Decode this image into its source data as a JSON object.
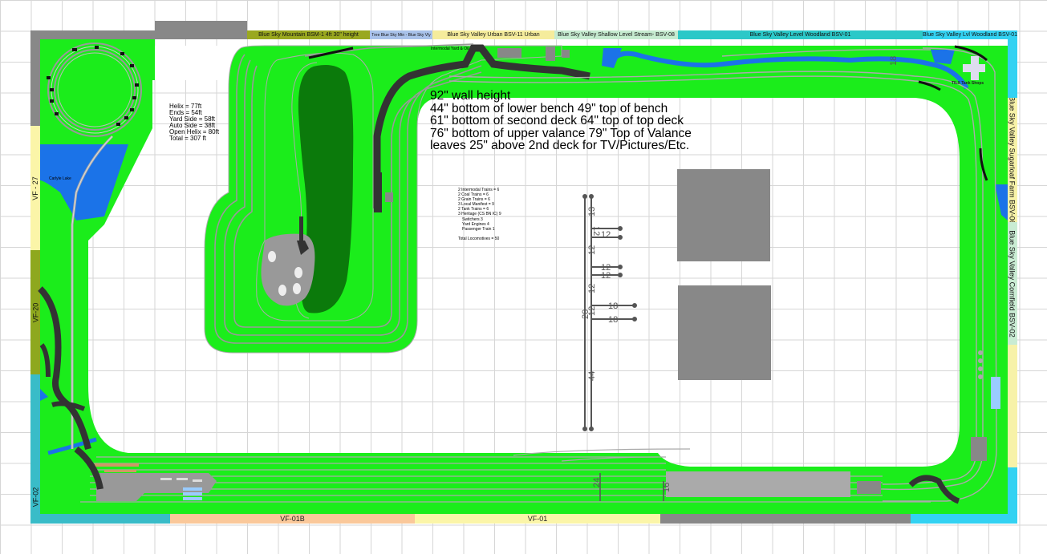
{
  "top_bands": [
    {
      "label": "Blue Sky Mountain BSM-1 4ft 30\" height",
      "color": "#9aa81f"
    },
    {
      "label": "Tree Blue Sky Mtn - Blue Sky Vly",
      "color": "#a9c2ea"
    },
    {
      "label": "Blue Sky Valley Urban BSV-11 Urban",
      "color": "#f5ec9c"
    },
    {
      "label": "Blue Sky Valley Shallow Level Stream- BSV-08",
      "color": "#c6ebd0"
    },
    {
      "label": "Blue Sky Valley Level Woodland  BSV-01",
      "color": "#2bc8c8"
    },
    {
      "label": "Blue Sky Valley Lvl Woodland  BSV-01",
      "color": "#33d2f2"
    }
  ],
  "right_bands": [
    {
      "label": "Blue Sky Valley Sugarloaf Farm BSV-06",
      "color": "#f7f2a8"
    },
    {
      "label": "Blue Sky Valley Cornfield  BSV-02",
      "color": "#c9ecd3"
    }
  ],
  "left_bands": [
    {
      "label": "VF - 27",
      "color": "#fbf5a8"
    },
    {
      "label": "VF-20",
      "color": "#8ea81e"
    },
    {
      "label": "VF-02",
      "color": "#39bcc8"
    }
  ],
  "bottom_bands": [
    {
      "label": "VF-01B",
      "color": "#fac89a"
    },
    {
      "label": "VF-01",
      "color": "#fbf5a8"
    }
  ],
  "specs": [
    "92\" wall height",
    "44\" bottom of lower bench 49\" top of bench",
    "61\" bottom of second deck 64\" top of top deck",
    "76\" bottom of upper valance 79\" Top of Valance",
    "leaves 25\" above 2nd deck for TV/Pictures/Etc."
  ],
  "lengths": [
    "Helix = 77ft",
    "Ends = 54ft",
    "Yard Side = 58ft",
    "Auto Side = 38ft",
    "Open Helix = 80ft",
    "Total = 307 ft"
  ],
  "trains": [
    "2 Intermodal Trains = 6",
    "2 Coal Trains = 6",
    "2 Grain Trains = 6",
    "3 Local Manifest = 9",
    "2 Tank Trains = 6",
    "3 Heritage (CS BN IC) 9",
    "Switchers 3",
    "Yard Engines 4",
    "Passenger Train 1",
    "",
    "Total Locomotives = 50"
  ],
  "labels": {
    "lake": "Carlyle Lake",
    "tank_shops": "TILX Tank Shops",
    "intermodal": "Intermodal Yard & Oil"
  },
  "dimension_labels": {
    "d13": "13",
    "d12a": "12",
    "d12b": "12",
    "d12c": "12",
    "d12d": "12",
    "d12e": "12",
    "d12f": "12",
    "d12g": "12",
    "d20": "20",
    "d18a": "18",
    "d18b": "18",
    "d44": "44",
    "d24": "24",
    "d16": "16",
    "d18top": "18"
  },
  "colors": {
    "grass": "#1bed1b",
    "water": "#1b73e8",
    "forest": "#0b7a0b",
    "road": "#333333",
    "building": "#888888"
  }
}
